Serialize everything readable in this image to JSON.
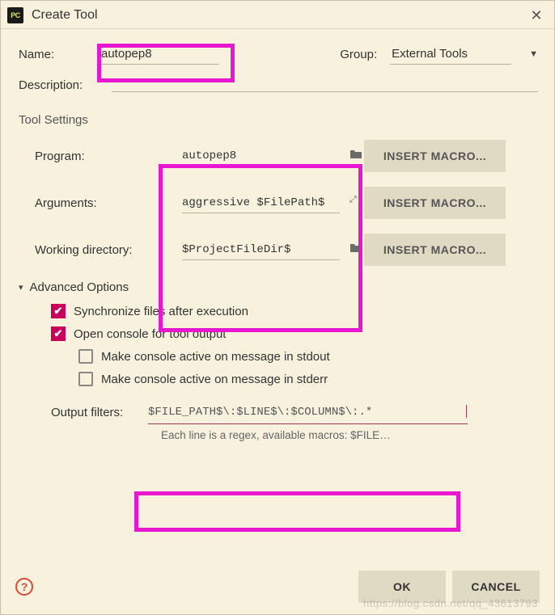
{
  "dialog": {
    "title": "Create Tool"
  },
  "form": {
    "name_label": "Name:",
    "name_value": "autopep8",
    "group_label": "Group:",
    "group_value": "External Tools",
    "description_label": "Description:",
    "description_value": ""
  },
  "tool_settings": {
    "heading": "Tool Settings",
    "rows": [
      {
        "label": "Program:",
        "value": "autopep8",
        "icon": "folder"
      },
      {
        "label": "Arguments:",
        "value": "aggressive $FilePath$",
        "icon": "expand"
      },
      {
        "label": "Working directory:",
        "value": "$ProjectFileDir$",
        "icon": "folder"
      }
    ],
    "insert_macro_label": "INSERT MACRO..."
  },
  "advanced": {
    "heading": "Advanced Options",
    "options": [
      {
        "label": "Synchronize files after execution",
        "checked": true,
        "sub": false
      },
      {
        "label": "Open console for tool output",
        "checked": true,
        "sub": false
      },
      {
        "label": "Make console active on message in stdout",
        "checked": false,
        "sub": true
      },
      {
        "label": "Make console active on message in stderr",
        "checked": false,
        "sub": true
      }
    ],
    "output_filters_label": "Output filters:",
    "output_filters_value": "$FILE_PATH$\\:$LINE$\\:$COLUMN$\\:.*",
    "hint": "Each line is a regex, available macros: $FILE_PATH$, $LINE$ a..."
  },
  "footer": {
    "ok": "OK",
    "cancel": "CANCEL"
  },
  "watermark": "https://blog.csdn.net/qq_43613793"
}
